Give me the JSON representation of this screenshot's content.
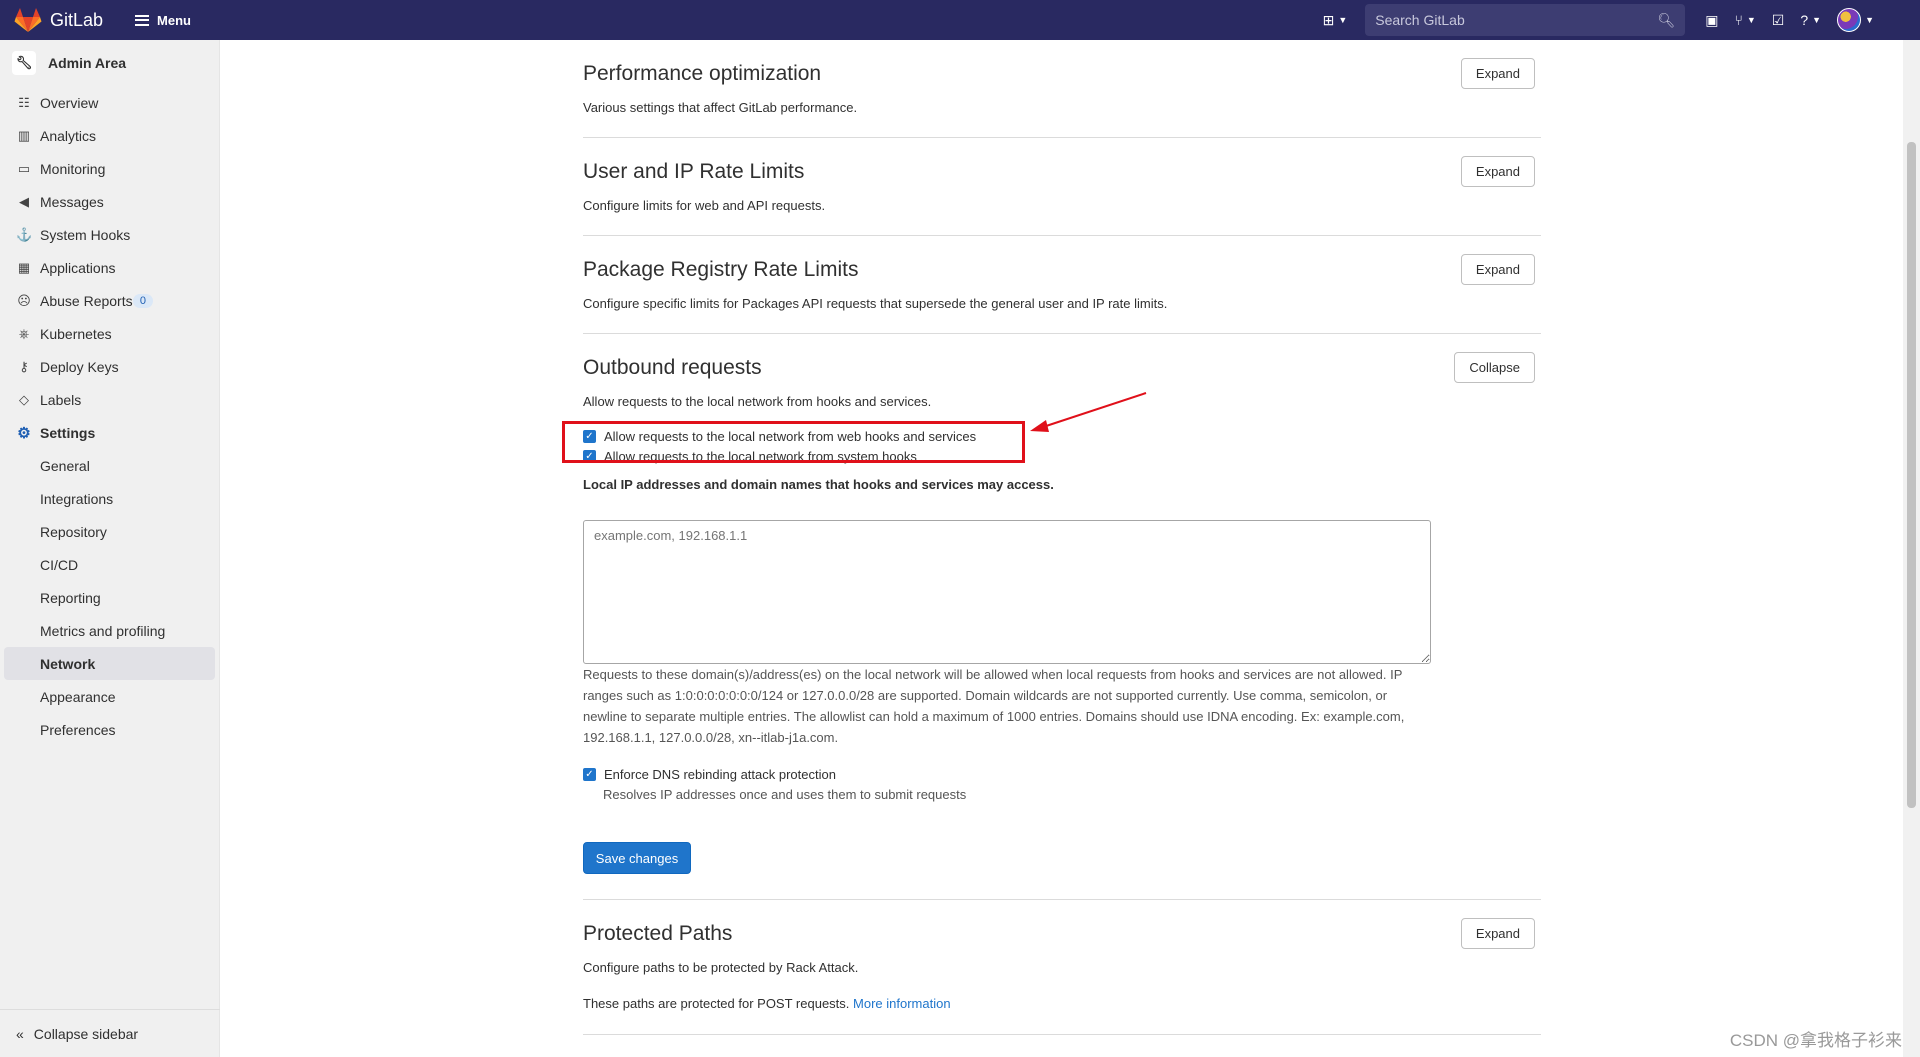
{
  "topbar": {
    "brand": "GitLab",
    "menu_label": "Menu",
    "search_placeholder": "Search GitLab",
    "icons": [
      "plus-square-icon",
      "search-icon",
      "issues-icon",
      "merge-request-icon",
      "todo-icon",
      "help-icon",
      "avatar"
    ]
  },
  "sidebar": {
    "title": "Admin Area",
    "items": [
      {
        "label": "Overview",
        "icon": "overview-icon"
      },
      {
        "label": "Analytics",
        "icon": "analytics-icon"
      },
      {
        "label": "Monitoring",
        "icon": "monitor-icon"
      },
      {
        "label": "Messages",
        "icon": "messages-icon"
      },
      {
        "label": "System Hooks",
        "icon": "hook-icon"
      },
      {
        "label": "Applications",
        "icon": "applications-icon"
      },
      {
        "label": "Abuse Reports",
        "icon": "abuse-icon",
        "count": "0"
      },
      {
        "label": "Kubernetes",
        "icon": "kubernetes-icon"
      },
      {
        "label": "Deploy Keys",
        "icon": "key-icon"
      },
      {
        "label": "Labels",
        "icon": "label-icon"
      },
      {
        "label": "Settings",
        "icon": "gear-icon"
      }
    ],
    "settings_sub": [
      "General",
      "Integrations",
      "Repository",
      "CI/CD",
      "Reporting",
      "Metrics and profiling",
      "Network",
      "Appearance",
      "Preferences"
    ],
    "current": "Network",
    "collapse_label": "Collapse sidebar"
  },
  "sections": {
    "performance": {
      "title": "Performance optimization",
      "desc": "Various settings that affect GitLab performance.",
      "button": "Expand"
    },
    "rate_limits": {
      "title": "User and IP Rate Limits",
      "desc": "Configure limits for web and API requests.",
      "button": "Expand"
    },
    "package_limits": {
      "title": "Package Registry Rate Limits",
      "desc": "Configure specific limits for Packages API requests that supersede the general user and IP rate limits.",
      "button": "Expand"
    },
    "outbound": {
      "title": "Outbound requests",
      "desc": "Allow requests to the local network from hooks and services.",
      "button": "Collapse",
      "check_web_hooks": "Allow requests to the local network from web hooks and services",
      "check_system_hooks": "Allow requests to the local network from system hooks",
      "allowlist_label": "Local IP addresses and domain names that hooks and services may access.",
      "allowlist_placeholder": "example.com, 192.168.1.1",
      "help_text": "Requests to these domain(s)/address(es) on the local network will be allowed when local requests from hooks and services are not allowed. IP ranges such as 1:0:0:0:0:0:0:0/124 or 127.0.0.0/28 are supported. Domain wildcards are not supported currently. Use comma, semicolon, or newline to separate multiple entries. The allowlist can hold a maximum of 1000 entries. Domains should use IDNA encoding. Ex: example.com, 192.168.1.1, 127.0.0.0/28, xn--itlab-j1a.com.",
      "dns_check": "Enforce DNS rebinding attack protection",
      "dns_help": "Resolves IP addresses once and uses them to submit requests",
      "save": "Save changes"
    },
    "protected_paths": {
      "title": "Protected Paths",
      "desc": "Configure paths to be protected by Rack Attack.",
      "button": "Expand",
      "note": "These paths are protected for POST requests.",
      "link": "More information"
    }
  },
  "annotation_color": "#e0101a",
  "watermark": "CSDN @拿我格子衫来"
}
